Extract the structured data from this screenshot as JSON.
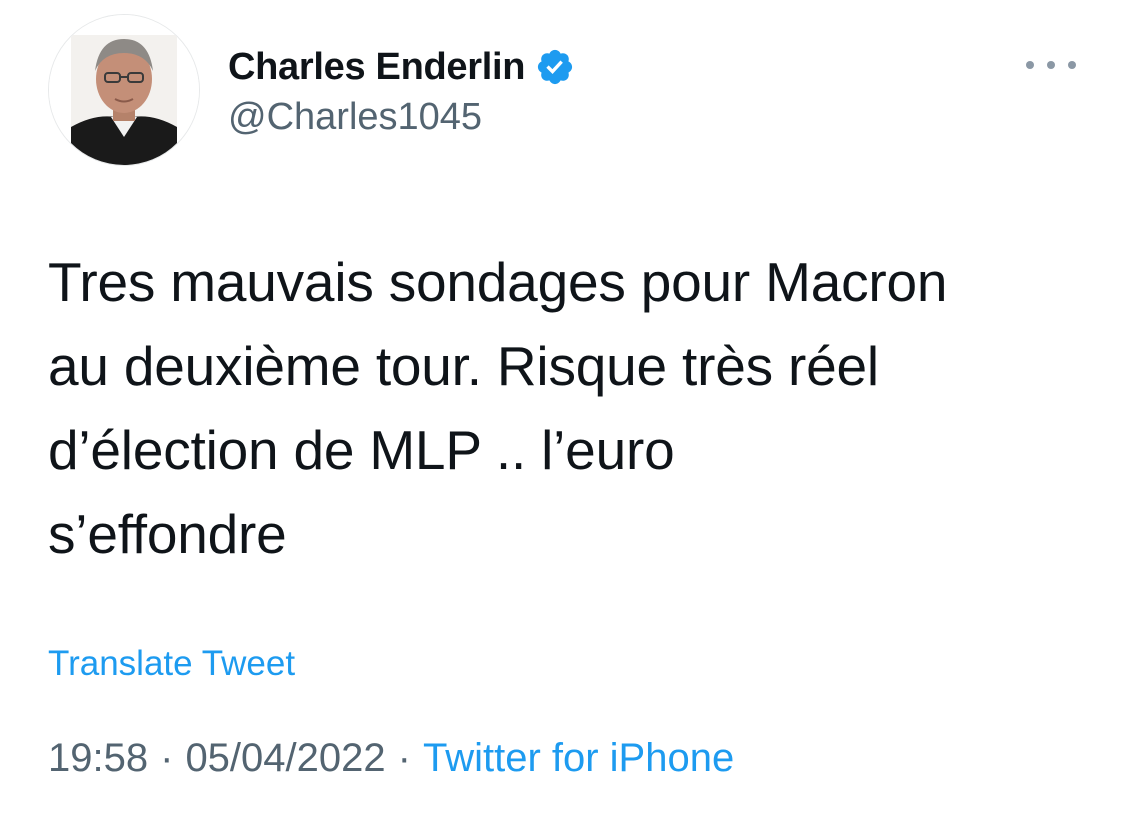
{
  "author": {
    "display_name": "Charles Enderlin",
    "handle": "@Charles1045",
    "verified_icon": "verified-badge-icon",
    "verified_color": "#1d9bf0"
  },
  "more_icon": "more-horizontal-icon",
  "tweet": {
    "lines": [
      "Tres mauvais sondages pour Macron",
      "au deuxième tour. Risque très réel",
      "d’élection de MLP .. l’euro",
      "s’effondre"
    ]
  },
  "translate_label": "Translate Tweet",
  "meta": {
    "time": "19:58",
    "separator": "·",
    "date": "05/04/2022",
    "source": "Twitter for iPhone"
  },
  "colors": {
    "text": "#0f1419",
    "secondary": "#536471",
    "link": "#1d9bf0"
  }
}
